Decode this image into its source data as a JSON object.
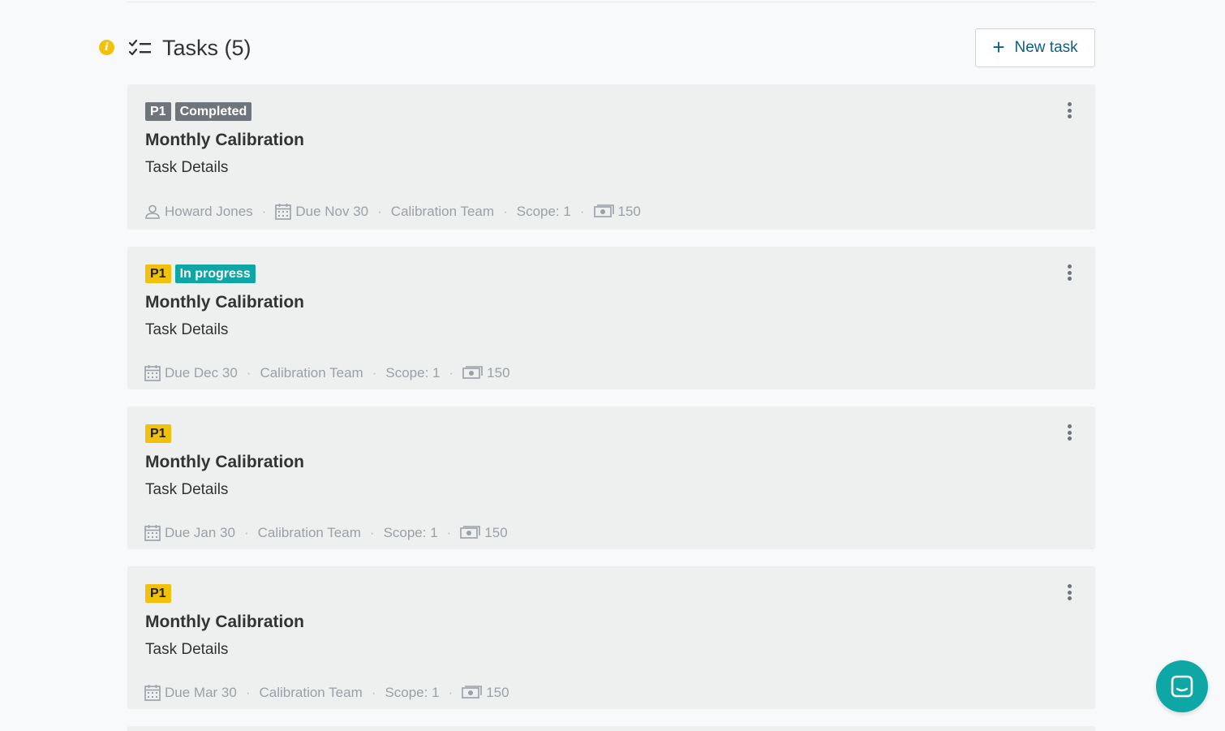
{
  "header": {
    "title": "Tasks (5)",
    "new_task_label": "New task"
  },
  "tasks": [
    {
      "priority": "P1",
      "priority_color": "#6e757b",
      "status": "Completed",
      "status_color": "#6e757b",
      "title": "Monthly Calibration",
      "subtitle": "Task Details",
      "assignee": "Howard Jones",
      "due": "Due Nov 30",
      "team": "Calibration Team",
      "scope": "Scope: 1",
      "amount": "150"
    },
    {
      "priority": "P1",
      "priority_color": "#f2c10c",
      "status": "In progress",
      "status_color": "#0fa6a6",
      "title": "Monthly Calibration",
      "subtitle": "Task Details",
      "due": "Due Dec 30",
      "team": "Calibration Team",
      "scope": "Scope: 1",
      "amount": "150"
    },
    {
      "priority": "P1",
      "priority_color": "#f2c10c",
      "title": "Monthly Calibration",
      "subtitle": "Task Details",
      "due": "Due Jan 30",
      "team": "Calibration Team",
      "scope": "Scope: 1",
      "amount": "150"
    },
    {
      "priority": "P1",
      "priority_color": "#f2c10c",
      "title": "Monthly Calibration",
      "subtitle": "Task Details",
      "due": "Due Mar 30",
      "team": "Calibration Team",
      "scope": "Scope: 1",
      "amount": "150"
    }
  ],
  "colors": {
    "accent": "#0e5f86",
    "chat": "#0fa6a6",
    "info": "#f2c10c"
  }
}
